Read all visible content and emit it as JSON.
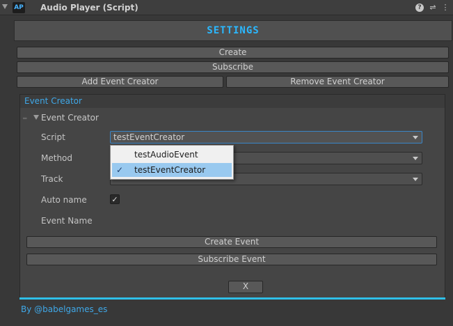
{
  "header": {
    "title": "Audio Player (Script)",
    "script_icon_text": "AP",
    "icons": [
      "help-icon",
      "preset-icon",
      "menu-icon"
    ]
  },
  "banner": {
    "text": "SETTINGS",
    "color": "#2bb8ff"
  },
  "buttons": {
    "create": "Create",
    "subscribe": "Subscribe",
    "add_event_creator": "Add Event Creator",
    "remove_event_creator": "Remove Event Creator"
  },
  "event_creator_panel": {
    "header": "Event Creator",
    "section_title": "Event Creator",
    "fields": {
      "script": {
        "label": "Script",
        "value": "testEventCreator"
      },
      "method": {
        "label": "Method",
        "value": ""
      },
      "track": {
        "label": "Track",
        "value": ""
      },
      "auto_name": {
        "label": "Auto name",
        "checked": true,
        "check_glyph": "✓"
      },
      "event_name": {
        "label": "Event Name"
      }
    },
    "create_event": "Create Event",
    "subscribe_event": "Subscribe Event",
    "close": "X",
    "accent_color": "#2fbfe8"
  },
  "dropdown": {
    "items": [
      {
        "label": "testAudioEvent",
        "selected": false,
        "check": ""
      },
      {
        "label": "testEventCreator",
        "selected": true,
        "check": "✓"
      }
    ]
  },
  "footer": {
    "text": "By @babelgames_es"
  }
}
